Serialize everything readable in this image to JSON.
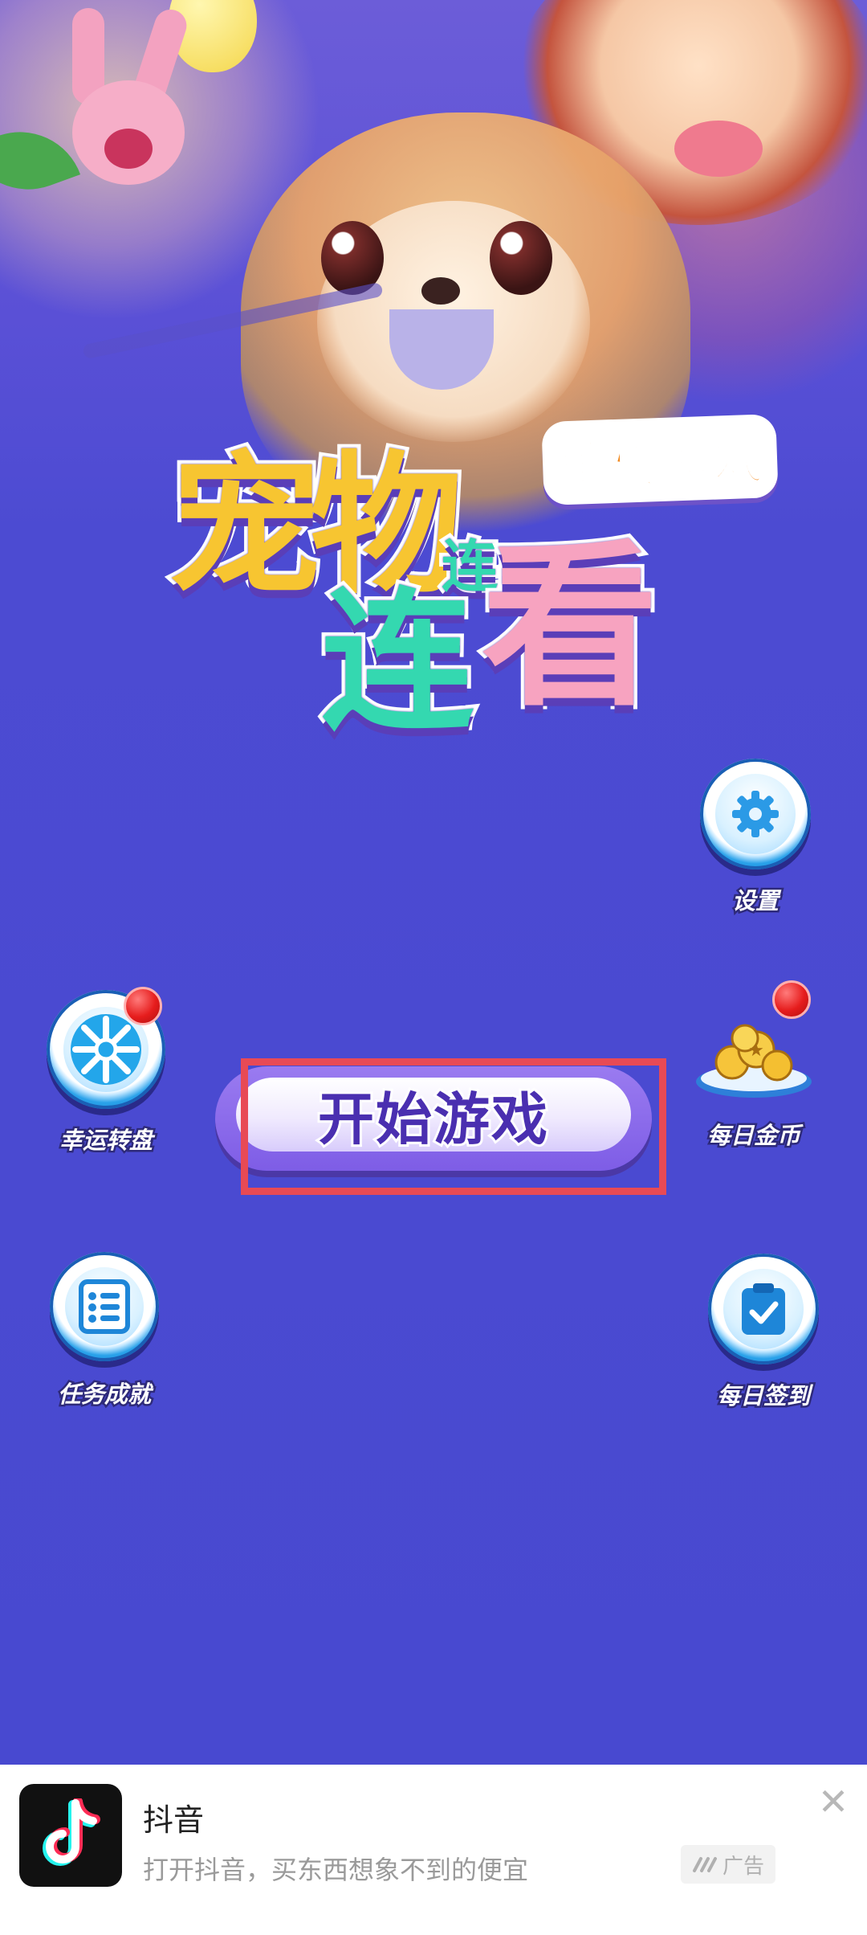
{
  "game": {
    "title_line1": "宠物",
    "title_line2": "连",
    "title_line3": "看",
    "title_small": "连",
    "badge": "单机游戏",
    "start_button": "开始游戏",
    "buttons": {
      "settings": "设置",
      "lucky_wheel": "幸运转盘",
      "daily_coins": "每日金币",
      "tasks": "任务成就",
      "daily_checkin": "每日签到"
    }
  },
  "ad": {
    "app_name": "抖音",
    "description": "打开抖音，买东西想象不到的便宜",
    "tag": "广告",
    "close": "✕"
  },
  "colors": {
    "background": "#4a49cf",
    "highlight": "#e84a55",
    "accent_button": "#7e5de6",
    "icon_blue": "#2aa2ea",
    "notification_red": "#e61d1d"
  },
  "icons": [
    "settings-gear-icon",
    "lucky-wheel-icon",
    "coins-plate-icon",
    "task-list-icon",
    "checkin-clipboard-icon",
    "tiktok-logo-icon",
    "ad-brand-icon",
    "close-icon"
  ]
}
